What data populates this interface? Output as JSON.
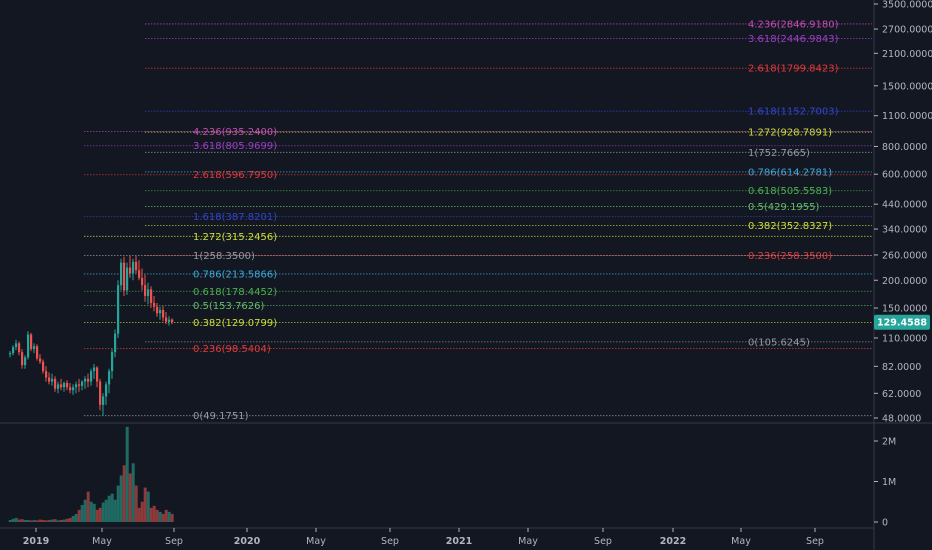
{
  "chart_data": {
    "type": "candlestick",
    "price_scale": "log",
    "price_ticks": [
      "3500.0000",
      "2700.0000",
      "2100.0000",
      "1500.0000",
      "1100.0000",
      "800.0000",
      "600.0000",
      "440.0000",
      "340.0000",
      "260.0000",
      "200.0000",
      "150.0000",
      "110.0000",
      "82.0000",
      "62.0000",
      "48.0000"
    ],
    "volume_ticks": [
      "2M",
      "1M",
      "0"
    ],
    "time_ticks": [
      "2019",
      "May",
      "Sep",
      "2020",
      "May",
      "Sep",
      "2021",
      "May",
      "Sep",
      "2022",
      "May",
      "Sep"
    ],
    "last_price": "129.4588",
    "colors": {
      "up": "#26a69a",
      "down": "#ef5350",
      "up_vol": "#1f6b64",
      "down_vol": "#8e3a3a",
      "badge": "#26a69a"
    },
    "fib_upper": [
      {
        "label": "4.236(2846.9180)",
        "color": "#c54bb7"
      },
      {
        "label": "3.618(2446.9843)",
        "color": "#9c3fc4"
      },
      {
        "label": "2.618(1799.8423)",
        "color": "#e03a3a"
      },
      {
        "label": "1.618(1152.7003)",
        "color": "#3345c9"
      },
      {
        "label": "1.272(928.7891)",
        "color": "#cddc39"
      },
      {
        "label": "1(752.7665)",
        "color": "#9598a1"
      },
      {
        "label": "0.786(614.2781)",
        "color": "#3ba9d6"
      },
      {
        "label": "0.618(505.5583)",
        "color": "#4caf50"
      },
      {
        "label": "0.5(429.1955)",
        "color": "#66bb6a"
      },
      {
        "label": "0.382(352.8327)",
        "color": "#cddc39"
      },
      {
        "label": "0.236(258.3500)",
        "color": "#e03a3a"
      },
      {
        "label": "0(105.6245)",
        "color": "#9598a1"
      }
    ],
    "fib_lower": [
      {
        "label": "4.236(935.2400)",
        "color": "#c54bb7"
      },
      {
        "label": "3.618(805.9699)",
        "color": "#9c3fc4"
      },
      {
        "label": "2.618(596.7950)",
        "color": "#e03a3a"
      },
      {
        "label": "1.618(387.8201)",
        "color": "#3345c9"
      },
      {
        "label": "1.272(315.2456)",
        "color": "#cddc39"
      },
      {
        "label": "1(258.3500)",
        "color": "#9598a1"
      },
      {
        "label": "0.786(213.5866)",
        "color": "#3ba9d6"
      },
      {
        "label": "0.618(178.4452)",
        "color": "#4caf50"
      },
      {
        "label": "0.5(153.7626)",
        "color": "#66bb6a"
      },
      {
        "label": "0.382(129.0799)",
        "color": "#cddc39"
      },
      {
        "label": "0.236(98.5404)",
        "color": "#e03a3a"
      },
      {
        "label": "0(49.1751)",
        "color": "#9598a1"
      }
    ],
    "candles": [
      [
        94,
        96,
        90,
        94
      ],
      [
        94,
        102,
        92,
        100
      ],
      [
        100,
        108,
        97,
        104
      ],
      [
        104,
        106,
        92,
        95
      ],
      [
        95,
        98,
        80,
        83
      ],
      [
        83,
        92,
        80,
        90
      ],
      [
        90,
        118,
        88,
        114
      ],
      [
        114,
        116,
        96,
        98
      ],
      [
        98,
        104,
        94,
        101
      ],
      [
        101,
        103,
        87,
        89
      ],
      [
        89,
        93,
        84,
        86
      ],
      [
        86,
        88,
        76,
        78
      ],
      [
        78,
        82,
        70,
        73
      ],
      [
        73,
        77,
        68,
        70
      ],
      [
        70,
        76,
        67,
        72
      ],
      [
        72,
        74,
        63,
        65
      ],
      [
        65,
        70,
        62,
        68
      ],
      [
        68,
        72,
        64,
        66
      ],
      [
        66,
        70,
        63,
        69
      ],
      [
        69,
        71,
        64,
        66
      ],
      [
        66,
        69,
        62,
        64
      ],
      [
        64,
        68,
        61,
        66
      ],
      [
        66,
        70,
        62,
        68
      ],
      [
        68,
        72,
        63,
        67
      ],
      [
        67,
        71,
        64,
        70
      ],
      [
        70,
        74,
        65,
        72
      ],
      [
        72,
        76,
        66,
        70
      ],
      [
        70,
        80,
        67,
        78
      ],
      [
        78,
        84,
        72,
        81
      ],
      [
        81,
        82,
        66,
        70
      ],
      [
        70,
        72,
        52,
        55
      ],
      [
        55,
        62,
        49,
        60
      ],
      [
        60,
        70,
        55,
        68
      ],
      [
        68,
        80,
        62,
        78
      ],
      [
        78,
        98,
        72,
        95
      ],
      [
        95,
        120,
        90,
        115
      ],
      [
        115,
        200,
        110,
        190
      ],
      [
        190,
        250,
        180,
        240
      ],
      [
        240,
        255,
        170,
        180
      ],
      [
        180,
        240,
        172,
        228
      ],
      [
        228,
        258,
        205,
        215
      ],
      [
        215,
        250,
        200,
        242
      ],
      [
        242,
        258,
        215,
        222
      ],
      [
        222,
        246,
        200,
        205
      ],
      [
        205,
        226,
        180,
        190
      ],
      [
        190,
        212,
        160,
        170
      ],
      [
        170,
        195,
        156,
        182
      ],
      [
        182,
        188,
        150,
        158
      ],
      [
        158,
        170,
        145,
        152
      ],
      [
        152,
        158,
        137,
        142
      ],
      [
        142,
        152,
        133,
        147
      ],
      [
        147,
        153,
        131,
        136
      ],
      [
        136,
        144,
        127,
        130
      ],
      [
        130,
        138,
        125,
        133
      ],
      [
        133,
        135,
        127,
        129.5
      ]
    ],
    "volumes": [
      0.05,
      0.08,
      0.1,
      0.06,
      0.07,
      0.05,
      0.05,
      0.04,
      0.05,
      0.04,
      0.06,
      0.05,
      0.04,
      0.05,
      0.06,
      0.07,
      0.04,
      0.05,
      0.06,
      0.08,
      0.1,
      0.15,
      0.2,
      0.3,
      0.42,
      0.55,
      0.75,
      0.5,
      0.45,
      0.3,
      0.35,
      0.48,
      0.55,
      0.65,
      0.7,
      0.55,
      0.9,
      1.15,
      1.4,
      2.35,
      1.2,
      1.45,
      0.9,
      0.35,
      0.5,
      0.85,
      0.75,
      0.35,
      0.4,
      0.3,
      0.25,
      0.2,
      0.3,
      0.25,
      0.2
    ]
  }
}
